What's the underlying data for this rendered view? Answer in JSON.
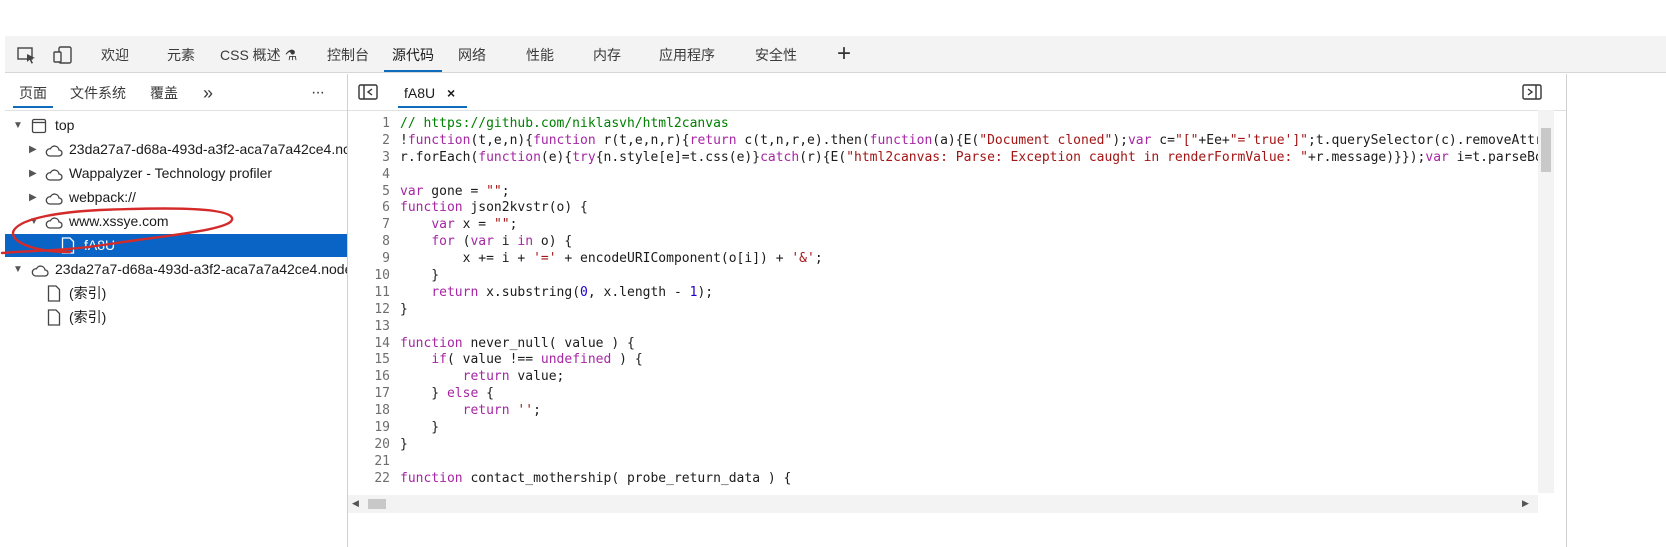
{
  "toolbar": {
    "icons": [
      "inspect-icon",
      "device-emulation-icon"
    ],
    "tabs": [
      {
        "label": "欢迎"
      },
      {
        "label": "元素"
      },
      {
        "label": "CSS 概述 ⚗"
      },
      {
        "label": "控制台"
      },
      {
        "label": "源代码",
        "active": true
      },
      {
        "label": "网络"
      },
      {
        "label": "性能"
      },
      {
        "label": "内存"
      },
      {
        "label": "应用程序"
      },
      {
        "label": "安全性"
      }
    ],
    "add_tab": "+"
  },
  "sources": {
    "subtabs": [
      {
        "label": "页面",
        "active": true
      },
      {
        "label": "文件系统"
      },
      {
        "label": "覆盖"
      }
    ],
    "more_tabs": "»",
    "more_menu": "···",
    "tree": [
      {
        "label": "top",
        "icon": "frame-icon"
      },
      {
        "label": "23da27a7-d68a-493d-a3f2-aca7a7a42ce4.nc",
        "icon": "cloud-icon"
      },
      {
        "label": "Wappalyzer - Technology profiler",
        "icon": "cloud-icon"
      },
      {
        "label": "webpack://",
        "icon": "cloud-icon"
      },
      {
        "label": "www.xssye.com",
        "icon": "cloud-icon"
      },
      {
        "label": "fA8U",
        "icon": "file-icon",
        "selected": true
      },
      {
        "label": "23da27a7-d68a-493d-a3f2-aca7a7a42ce4.node",
        "icon": "cloud-icon"
      },
      {
        "label": "(索引)",
        "icon": "file-icon"
      },
      {
        "label": "(索引)",
        "icon": "file-icon"
      }
    ]
  },
  "editor": {
    "tab_label": "fA8U",
    "close_glyph": "×",
    "lines": [
      {
        "n": "1",
        "t": "// https://github.com/niklasvh/html2canvas"
      },
      {
        "n": "2",
        "t": "!function(t,e,n){function r(t,e,n,r){return c(t,n,r,e).then(function(a){E(\"Document cloned\");var c=\"[\"+Ee+\"='true']\";t.querySelector(c).removeAttri"
      },
      {
        "n": "3",
        "t": "r.forEach(function(e){try{n.style[e]=t.css(e)}catch(r){E(\"html2canvas: Parse: Exception caught in renderFormValue: \"+r.message)}});var i=t.parseBou"
      },
      {
        "n": "4",
        "t": ""
      },
      {
        "n": "5",
        "t": "var gone = \"\";"
      },
      {
        "n": "6",
        "t": "function json2kvstr(o) {"
      },
      {
        "n": "7",
        "t": "    var x = \"\";"
      },
      {
        "n": "8",
        "t": "    for (var i in o) {"
      },
      {
        "n": "9",
        "t": "        x += i + '=' + encodeURIComponent(o[i]) + '&';"
      },
      {
        "n": "10",
        "t": "    }"
      },
      {
        "n": "11",
        "t": "    return x.substring(0, x.length - 1);"
      },
      {
        "n": "12",
        "t": "}"
      },
      {
        "n": "13",
        "t": ""
      },
      {
        "n": "14",
        "t": "function never_null( value ) {"
      },
      {
        "n": "15",
        "t": "    if( value !== undefined ) {"
      },
      {
        "n": "16",
        "t": "        return value;"
      },
      {
        "n": "17",
        "t": "    } else {"
      },
      {
        "n": "18",
        "t": "        return '';"
      },
      {
        "n": "19",
        "t": "    }"
      },
      {
        "n": "20",
        "t": "}"
      },
      {
        "n": "21",
        "t": ""
      },
      {
        "n": "22",
        "t": "function contact_mothership( probe_return_data ) {"
      }
    ]
  }
}
